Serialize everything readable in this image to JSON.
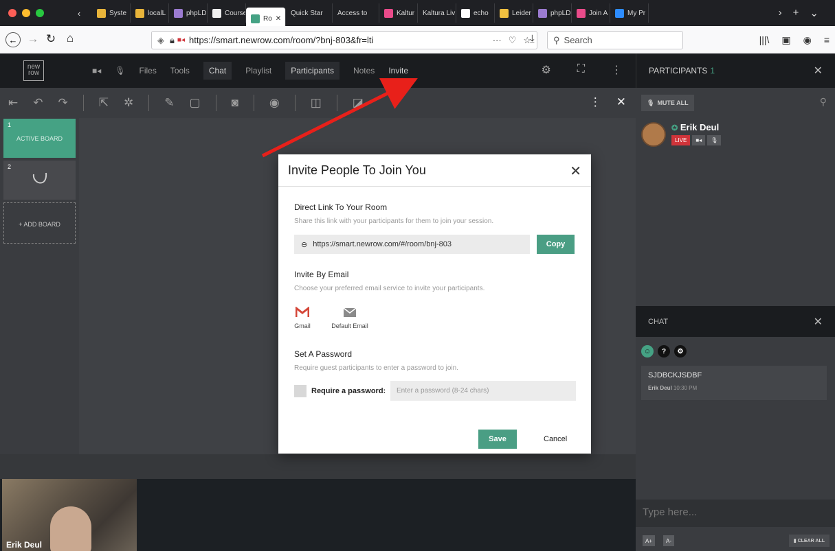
{
  "browser": {
    "tabs": [
      {
        "label": "Syste",
        "color": "#e8b43a"
      },
      {
        "label": "localL",
        "color": "#e8b43a"
      },
      {
        "label": "phpLD",
        "color": "#9b7bd0"
      },
      {
        "label": "Course",
        "color": "#f0f0f0"
      },
      {
        "label": "Ro",
        "color": "#45a284",
        "active": true
      },
      {
        "label": "Quick Star",
        "color": ""
      },
      {
        "label": "Access to",
        "color": ""
      },
      {
        "label": "Kaltur",
        "color": "#e94b8a"
      },
      {
        "label": "Kaltura Liv",
        "color": ""
      },
      {
        "label": "echo",
        "color": "#ffffff"
      },
      {
        "label": "Leider",
        "color": "#f0c040"
      },
      {
        "label": "phpLD",
        "color": "#9b7bd0"
      },
      {
        "label": "Join A",
        "color": "#e94b8a"
      },
      {
        "label": "My Pr",
        "color": "#2d8cff"
      }
    ],
    "url": "https://smart.newrow.com/room/?bnj-803&fr=lti",
    "search_placeholder": "Search",
    "url_domain": "newrow.com"
  },
  "app": {
    "logo_top": "new",
    "logo_bottom": "row",
    "nav": [
      "Files",
      "Tools",
      "Chat",
      "Playlist",
      "Participants",
      "Notes",
      "Invite"
    ],
    "participants_title": "PARTICIPANTS",
    "participants_count": "1"
  },
  "boards": {
    "items": [
      {
        "num": "1",
        "label": "ACTIVE BOARD"
      },
      {
        "num": "2",
        "label": ""
      }
    ],
    "add_label": "+ ADD BOARD"
  },
  "participants": {
    "mute_all": "MUTE ALL",
    "person_name": "Erik Deul",
    "live": "LIVE"
  },
  "chat": {
    "title": "CHAT",
    "message_text": "SJDBCKJSDBF",
    "message_author": "Erik Deul",
    "message_time": "10:30 PM",
    "input_placeholder": "Type here...",
    "font_up": "A+",
    "font_down": "A-",
    "clear_all": "CLEAR ALL"
  },
  "video": {
    "name": "Erik Deul"
  },
  "modal": {
    "title": "Invite People To Join You",
    "direct_link_title": "Direct Link To Your Room",
    "direct_link_desc": "Share this link with your participants for them to join your session.",
    "link": "https://smart.newrow.com/#/room/bnj-803",
    "copy": "Copy",
    "email_title": "Invite By Email",
    "email_desc": "Choose your preferred email service to invite your participants.",
    "gmail": "Gmail",
    "default_email": "Default Email",
    "password_title": "Set A Password",
    "password_desc": "Require guest participants to enter a password to join.",
    "password_label": "Require a password:",
    "password_placeholder": "Enter a password (8-24 chars)",
    "save": "Save",
    "cancel": "Cancel"
  },
  "colors": {
    "accent": "#45a284",
    "annotation_arrow": "#e8201a",
    "live": "#d0343a"
  }
}
